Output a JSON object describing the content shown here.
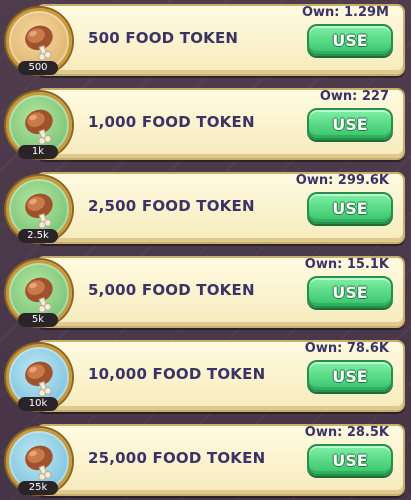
{
  "items": [
    {
      "title": "500 FOOD TOKEN",
      "own": "Own: 1.29M",
      "badge": "500",
      "button": "USE",
      "icon": "meat-drumstick-icon",
      "ring": "tan"
    },
    {
      "title": "1,000 FOOD TOKEN",
      "own": "Own: 227",
      "badge": "1k",
      "button": "USE",
      "icon": "meat-drumstick-icon",
      "ring": "green"
    },
    {
      "title": "2,500 FOOD TOKEN",
      "own": "Own: 299.6K",
      "badge": "2.5k",
      "button": "USE",
      "icon": "meat-drumstick-icon",
      "ring": "green"
    },
    {
      "title": "5,000 FOOD TOKEN",
      "own": "Own: 15.1K",
      "badge": "5k",
      "button": "USE",
      "icon": "meat-drumstick-icon",
      "ring": "green"
    },
    {
      "title": "10,000 FOOD TOKEN",
      "own": "Own: 78.6K",
      "badge": "10k",
      "button": "USE",
      "icon": "meat-drumstick-icon",
      "ring": "blue"
    },
    {
      "title": "25,000 FOOD TOKEN",
      "own": "Own: 28.5K",
      "badge": "25k",
      "button": "USE",
      "icon": "meat-drumstick-icon",
      "ring": "blue"
    }
  ],
  "colors": {
    "card": "#fffbe0",
    "text": "#3b3266",
    "button": "#36c46a",
    "background": "#4a3a4a"
  }
}
